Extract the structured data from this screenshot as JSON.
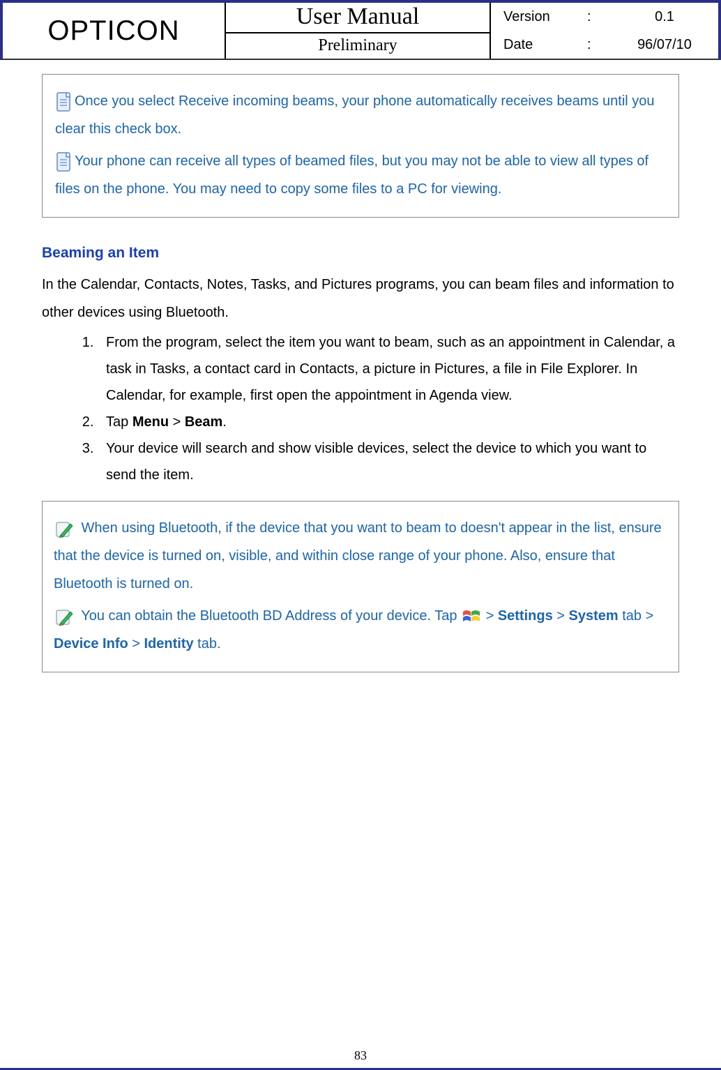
{
  "header": {
    "brand": "OPTICON",
    "title": "User Manual",
    "subtitle": "Preliminary",
    "version_label": "Version",
    "version_sep": ":",
    "version_value": "0.1",
    "date_label": "Date",
    "date_sep": ":",
    "date_value": "96/07/10"
  },
  "note1": {
    "p1": "Once you select Receive incoming beams, your phone automatically receives beams until you clear this check box.",
    "p2": "Your phone can receive all types of beamed files, but you may not be able to view all types of files on the phone. You may need to copy some files to a PC for viewing."
  },
  "section": {
    "title": "Beaming an Item",
    "intro": "In the Calendar, Contacts, Notes, Tasks, and Pictures programs, you can beam files and information to other devices using Bluetooth.",
    "steps": {
      "s1": "From the program, select the item you want to beam, such as an appointment in Calendar, a task in Tasks, a contact card in Contacts, a picture in Pictures, a file in File Explorer. In Calendar, for example, first open the appointment in Agenda view.",
      "s2a": "Tap ",
      "s2b": "Menu",
      "s2c": " > ",
      "s2d": "Beam",
      "s2e": ".",
      "s3": "Your device will search and show visible devices, select the device to which you want to send the item."
    }
  },
  "tip": {
    "p1": " When using Bluetooth, if the device that you want to beam to doesn't appear in the list, ensure that the device is turned on, visible, and within close range of your phone. Also, ensure that Bluetooth is turned on.",
    "p2a": " You can obtain the Bluetooth BD Address of your device. Tap ",
    "p2b": " > ",
    "p2c": "Settings",
    "p2d": " > ",
    "p2e": "System",
    "p2f": " tab > ",
    "p2g": "Device Info",
    "p2h": " > ",
    "p2i": "Identity",
    "p2j": " tab."
  },
  "page_number": "83"
}
